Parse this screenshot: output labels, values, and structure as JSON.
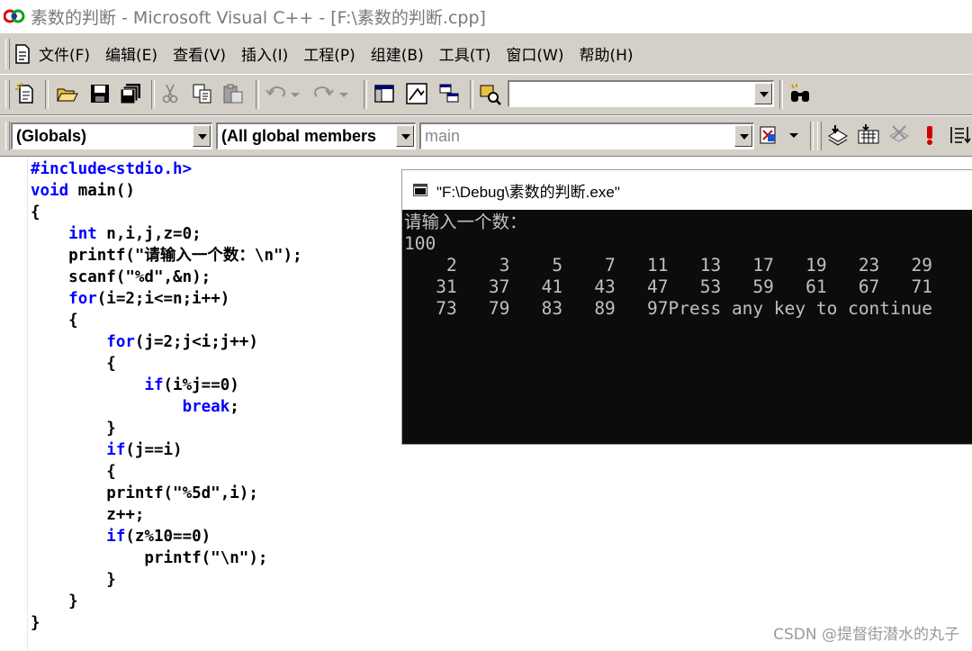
{
  "window": {
    "title": "素数的判断 - Microsoft Visual C++ - [F:\\素数的判断.cpp]"
  },
  "menu": [
    {
      "id": "file",
      "label": "文件(F)"
    },
    {
      "id": "edit",
      "label": "编辑(E)"
    },
    {
      "id": "view",
      "label": "查看(V)"
    },
    {
      "id": "insert",
      "label": "插入(I)"
    },
    {
      "id": "project",
      "label": "工程(P)"
    },
    {
      "id": "build",
      "label": "组建(B)"
    },
    {
      "id": "tools",
      "label": "工具(T)"
    },
    {
      "id": "window",
      "label": "窗口(W)"
    },
    {
      "id": "help",
      "label": "帮助(H)"
    }
  ],
  "toolbar": {
    "find_value": "",
    "scope_combo": "(Globals)",
    "members_combo": "(All global members",
    "function_combo": "main"
  },
  "editor": {
    "lines": [
      "#include<stdio.h>",
      "void main()",
      "{",
      "    int n,i,j,z=0;",
      "    printf(\"请输入一个数：\\n\");",
      "    scanf(\"%d\",&n);",
      "    for(i=2;i<=n;i++)",
      "    {",
      "        for(j=2;j<i;j++)",
      "        {",
      "            if(i%j==0)",
      "                break;",
      "        }",
      "        if(j==i)",
      "        {",
      "        printf(\"%5d\",i);",
      "        z++;",
      "        if(z%10==0)",
      "            printf(\"\\n\");",
      "        }",
      "    }",
      "}"
    ]
  },
  "console": {
    "title": "\"F:\\Debug\\素数的判断.exe\"",
    "lines": [
      "请输入一个数：",
      "100",
      "    2    3    5    7   11   13   17   19   23   29",
      "   31   37   41   43   47   53   59   61   67   71",
      "   73   79   83   89   97Press any key to continue"
    ]
  },
  "watermark": "CSDN @提督街潜水的丸子"
}
